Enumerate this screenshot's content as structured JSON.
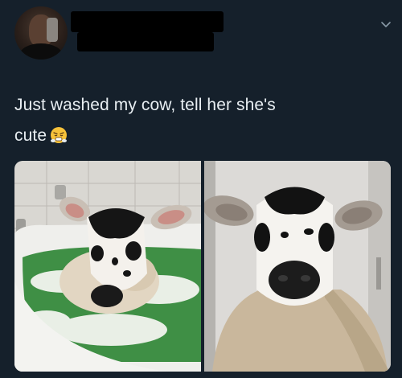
{
  "tweet": {
    "text_line1": "Just washed my cow, tell her she's",
    "text_line2": "cute",
    "emoji": "face-with-steam-from-nose"
  },
  "icons": {
    "menu": "chevron-down-icon"
  },
  "media": {
    "count": 2,
    "photos": [
      {
        "subject": "calf in bathtub"
      },
      {
        "subject": "calf wrapped in towel"
      }
    ]
  },
  "colors": {
    "background": "#15202b",
    "text": "#e8eef2",
    "caret": "#8899a6"
  }
}
